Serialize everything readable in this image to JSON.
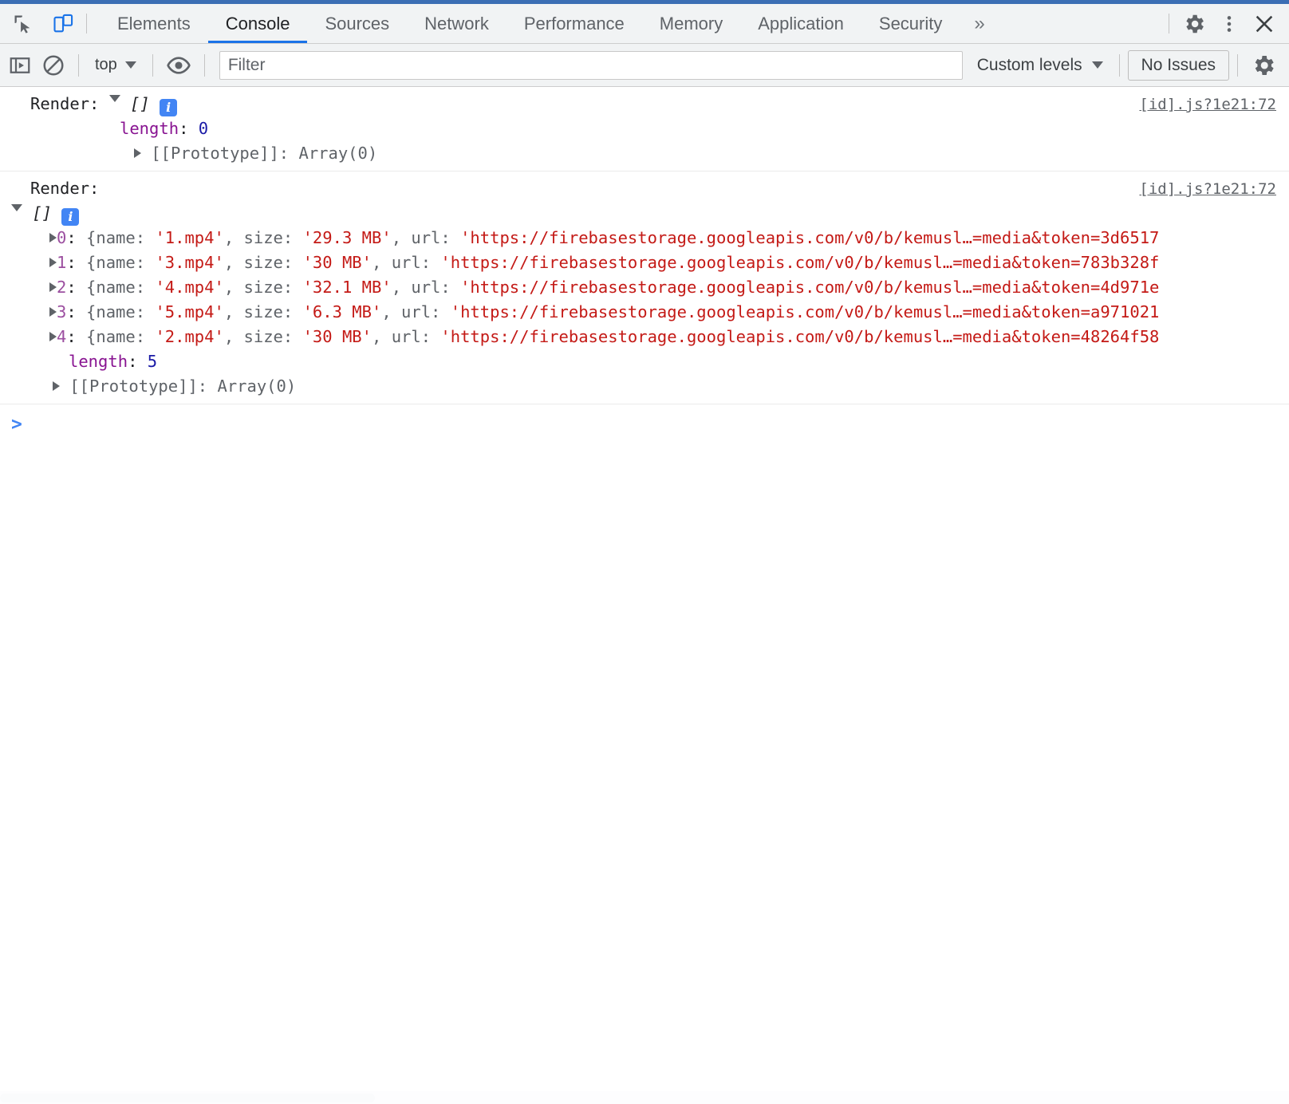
{
  "window": {
    "accent_color": "#3b6eb4"
  },
  "tabstrip": {
    "inspect_icon": "inspect-cursor-icon",
    "device_icon": "device-toolbar-icon",
    "tabs": [
      {
        "label": "Elements",
        "active": false
      },
      {
        "label": "Console",
        "active": true
      },
      {
        "label": "Sources",
        "active": false
      },
      {
        "label": "Network",
        "active": false
      },
      {
        "label": "Performance",
        "active": false
      },
      {
        "label": "Memory",
        "active": false
      },
      {
        "label": "Application",
        "active": false
      },
      {
        "label": "Security",
        "active": false
      }
    ],
    "more_tabs_label": "»",
    "settings_icon": "gear-icon",
    "menu_icon": "kebab-menu-icon",
    "close_icon": "close-icon",
    "active_tab_underline_color": "#1a73e8"
  },
  "console_toolbar": {
    "sidebar_icon": "console-sidebar-icon",
    "clear_icon": "clear-console-icon",
    "context": "top",
    "eye_icon": "live-expression-icon",
    "filter_placeholder": "Filter",
    "filter_value": "",
    "levels_label": "Custom levels",
    "issues_label": "No Issues",
    "settings_icon": "gear-icon"
  },
  "console": {
    "messages": [
      {
        "id": "msg-0",
        "prefix": "Render:",
        "array_label": "[]",
        "source": "[id].js?1e21:72",
        "expanded": true,
        "length_key": "length",
        "length_value": "0",
        "proto_label": "[[Prototype]]: Array(0)",
        "items": []
      },
      {
        "id": "msg-1",
        "prefix": "Render:",
        "array_label": "[]",
        "source": "[id].js?1e21:72",
        "expanded": true,
        "length_key": "length",
        "length_value": "5",
        "proto_label": "[[Prototype]]: Array(0)",
        "items": [
          {
            "index": "0",
            "name": "'1.mp4'",
            "size": "'29.3 MB'",
            "url": "'https://firebasestorage.googleapis.com/v0/b/kemusl…=media&token=3d6517"
          },
          {
            "index": "1",
            "name": "'3.mp4'",
            "size": "'30 MB'",
            "url": "'https://firebasestorage.googleapis.com/v0/b/kemusl…=media&token=783b328f"
          },
          {
            "index": "2",
            "name": "'4.mp4'",
            "size": "'32.1 MB'",
            "url": "'https://firebasestorage.googleapis.com/v0/b/kemusl…=media&token=4d971e"
          },
          {
            "index": "3",
            "name": "'5.mp4'",
            "size": "'6.3 MB'",
            "url": "'https://firebasestorage.googleapis.com/v0/b/kemusl…=media&token=a971021"
          },
          {
            "index": "4",
            "name": "'2.mp4'",
            "size": "'30 MB'",
            "url": "'https://firebasestorage.googleapis.com/v0/b/kemusl…=media&token=48264f58"
          }
        ]
      }
    ],
    "prompt_caret": ">",
    "prompt_value": "",
    "tokens": {
      "name_key": "name:",
      "size_key": "size:",
      "url_key": "url:",
      "open_brace": "{",
      "comma": ",",
      "colon": ":"
    }
  },
  "colors": {
    "string": "#c41a16",
    "number": "#1a1aa6",
    "property": "#881391",
    "info_badge": "#4285f4",
    "link": "#5f6368"
  }
}
